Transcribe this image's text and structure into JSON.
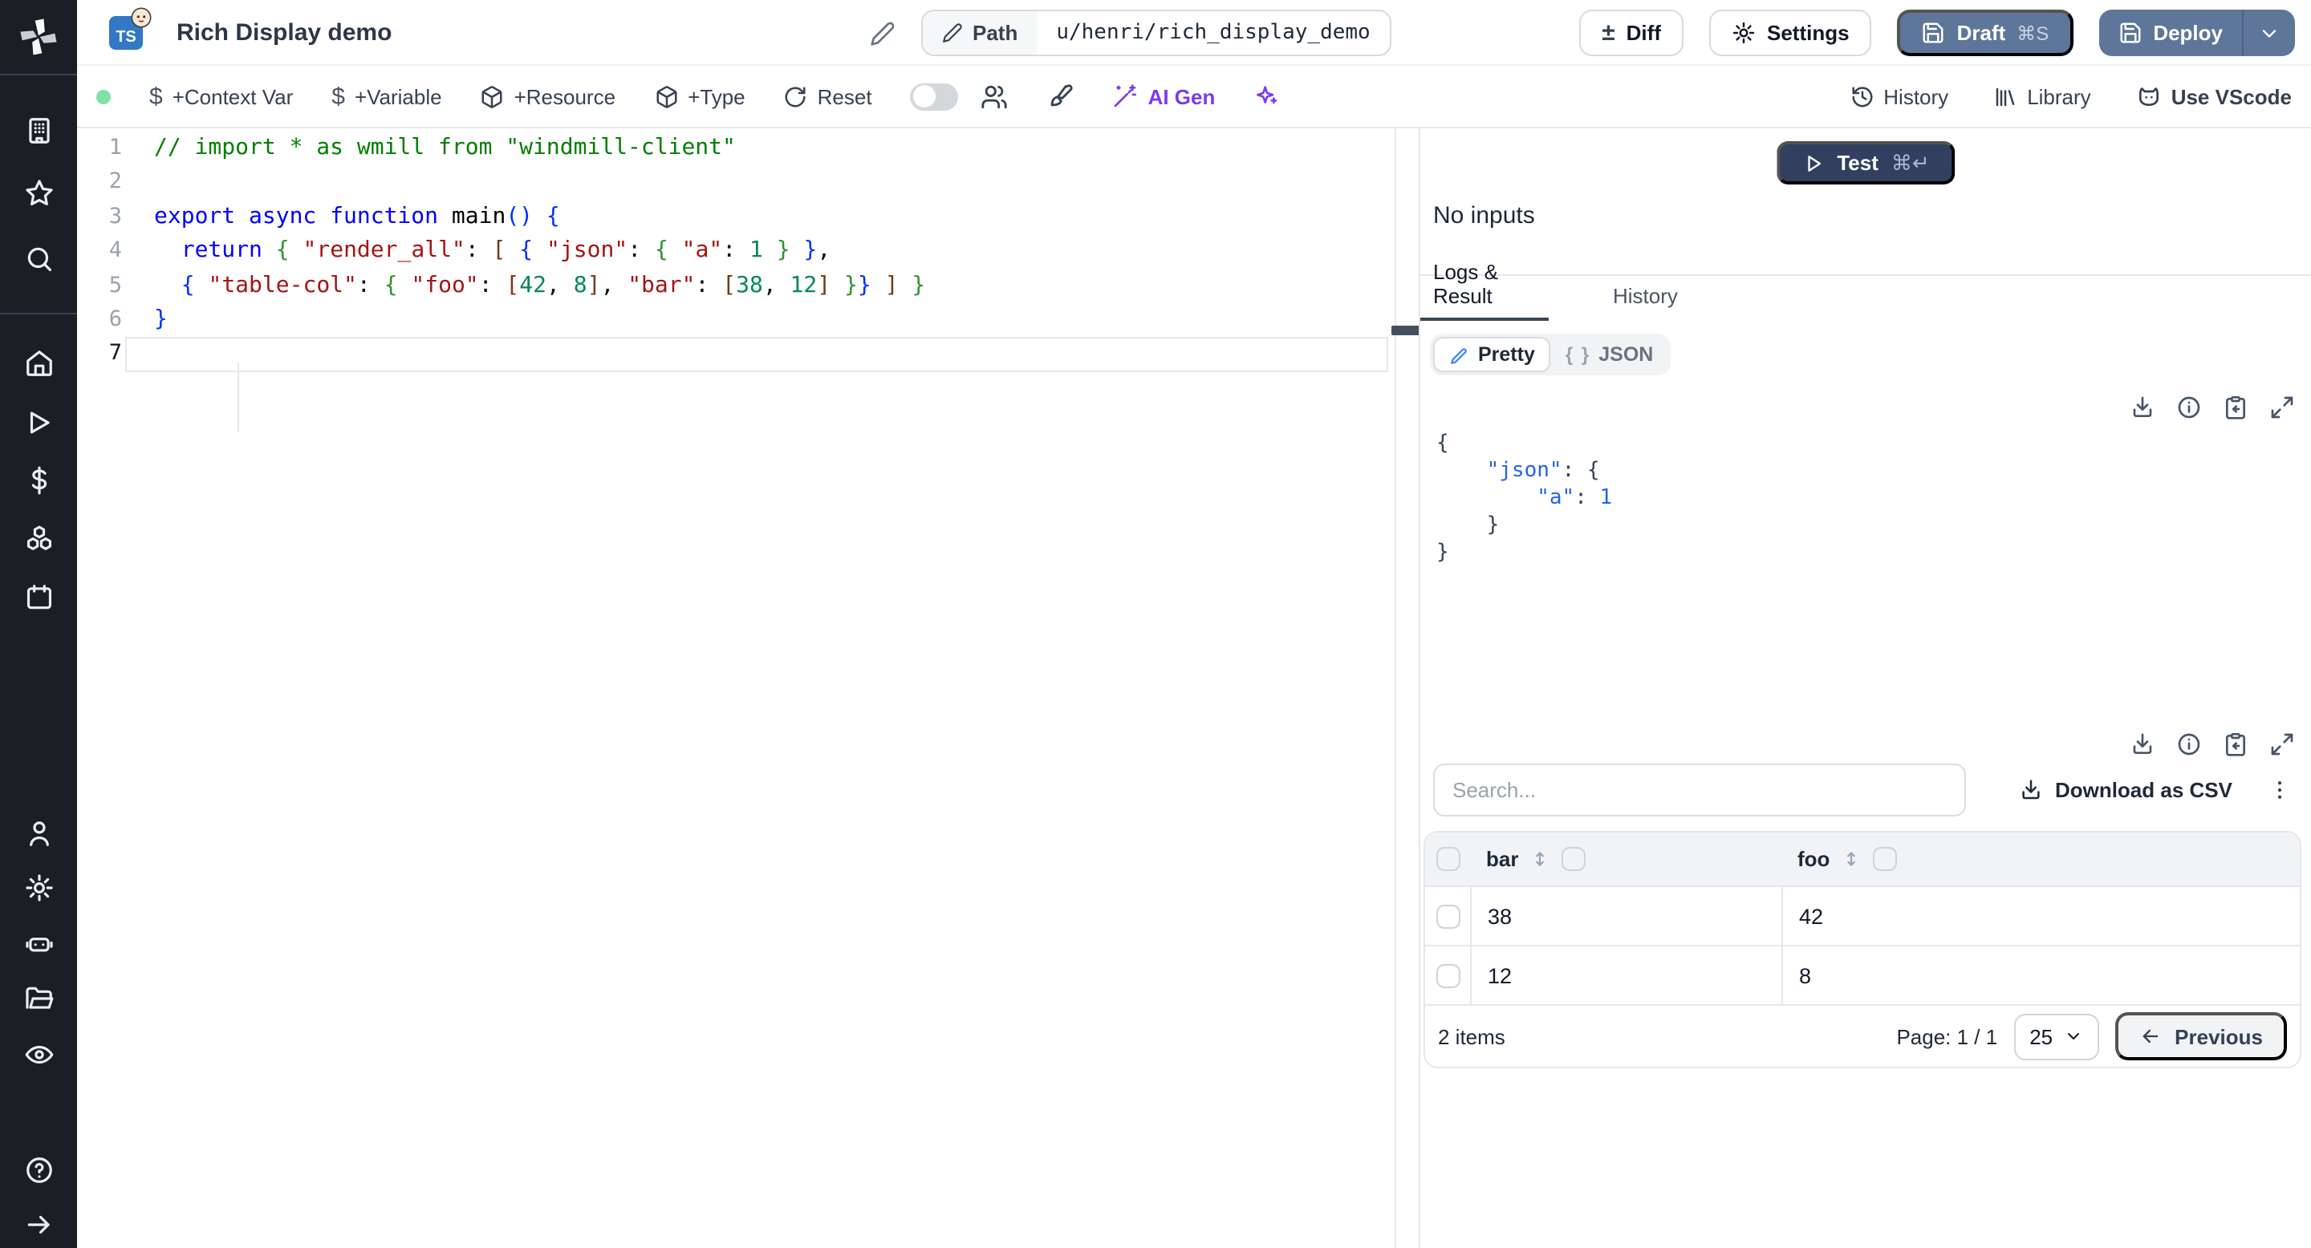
{
  "colors": {
    "accent_slate": "#5e7699",
    "accent_navy": "#323f5e",
    "accent_purple": "#7c3aed",
    "status_green_dot": "#7fe0a7",
    "tab_underline": "#3b4656",
    "sidebar_bg": "#1b1e24",
    "ts_badge_blue": "#3178c6"
  },
  "sidebar": {
    "icons": [
      "windmill-logo",
      "building",
      "star",
      "search",
      "home",
      "play",
      "dollar",
      "cubes",
      "calendar",
      "user",
      "gear",
      "robot",
      "folder-open",
      "eye",
      "help",
      "arrow-right"
    ]
  },
  "header": {
    "title": "Rich Display demo",
    "ts_badge": "TS",
    "path_label": "Path",
    "path_value": "u/henri/rich_display_demo",
    "diff_label": "Diff",
    "diff_glyph": "±",
    "settings_label": "Settings",
    "draft_label": "Draft",
    "draft_shortcut": "⌘S",
    "deploy_label": "Deploy"
  },
  "toolbar": {
    "dollar_glyph": "$",
    "context_var": "+Context Var",
    "variable": "+Variable",
    "resource": "+Resource",
    "type": "+Type",
    "reset": "Reset",
    "ai_gen": "AI Gen",
    "history": "History",
    "library": "Library",
    "use_vscode": "Use VScode"
  },
  "editor": {
    "lines": [
      {
        "num": "1",
        "tokens": [
          {
            "t": "// import * as wmill from \"windmill-client\"",
            "c": "com"
          }
        ]
      },
      {
        "num": "2",
        "tokens": []
      },
      {
        "num": "3",
        "tokens": [
          {
            "t": "export async function ",
            "c": "kw"
          },
          {
            "t": "main",
            "c": "fn"
          },
          {
            "t": "()",
            "c": "b1"
          },
          {
            "t": " ",
            "c": "pln"
          },
          {
            "t": "{",
            "c": "b1"
          }
        ]
      },
      {
        "num": "4",
        "tokens": [
          {
            "t": "  ",
            "c": "pln"
          },
          {
            "t": "return",
            "c": "kw"
          },
          {
            "t": " ",
            "c": "pln"
          },
          {
            "t": "{",
            "c": "b2"
          },
          {
            "t": " ",
            "c": "pln"
          },
          {
            "t": "\"render_all\"",
            "c": "str"
          },
          {
            "t": ": ",
            "c": "pln"
          },
          {
            "t": "[",
            "c": "b3"
          },
          {
            "t": " ",
            "c": "pln"
          },
          {
            "t": "{",
            "c": "b1"
          },
          {
            "t": " ",
            "c": "pln"
          },
          {
            "t": "\"json\"",
            "c": "str"
          },
          {
            "t": ": ",
            "c": "pln"
          },
          {
            "t": "{",
            "c": "b2"
          },
          {
            "t": " ",
            "c": "pln"
          },
          {
            "t": "\"a\"",
            "c": "str"
          },
          {
            "t": ": ",
            "c": "pln"
          },
          {
            "t": "1",
            "c": "num"
          },
          {
            "t": " ",
            "c": "pln"
          },
          {
            "t": "}",
            "c": "b2"
          },
          {
            "t": " ",
            "c": "pln"
          },
          {
            "t": "}",
            "c": "b1"
          },
          {
            "t": ",",
            "c": "pln"
          }
        ]
      },
      {
        "num": "5",
        "tokens": [
          {
            "t": "  ",
            "c": "pln"
          },
          {
            "t": "{",
            "c": "b1"
          },
          {
            "t": " ",
            "c": "pln"
          },
          {
            "t": "\"table-col\"",
            "c": "str"
          },
          {
            "t": ": ",
            "c": "pln"
          },
          {
            "t": "{",
            "c": "b2"
          },
          {
            "t": " ",
            "c": "pln"
          },
          {
            "t": "\"foo\"",
            "c": "str"
          },
          {
            "t": ": ",
            "c": "pln"
          },
          {
            "t": "[",
            "c": "b3"
          },
          {
            "t": "42",
            "c": "num"
          },
          {
            "t": ", ",
            "c": "pln"
          },
          {
            "t": "8",
            "c": "num"
          },
          {
            "t": "]",
            "c": "b3"
          },
          {
            "t": ", ",
            "c": "pln"
          },
          {
            "t": "\"bar\"",
            "c": "str"
          },
          {
            "t": ": ",
            "c": "pln"
          },
          {
            "t": "[",
            "c": "b3"
          },
          {
            "t": "38",
            "c": "num"
          },
          {
            "t": ", ",
            "c": "pln"
          },
          {
            "t": "12",
            "c": "num"
          },
          {
            "t": "]",
            "c": "b3"
          },
          {
            "t": " ",
            "c": "pln"
          },
          {
            "t": "}",
            "c": "b2"
          },
          {
            "t": "}",
            "c": "b1"
          },
          {
            "t": " ",
            "c": "pln"
          },
          {
            "t": "]",
            "c": "b3"
          },
          {
            "t": " ",
            "c": "pln"
          },
          {
            "t": "}",
            "c": "b2"
          }
        ]
      },
      {
        "num": "6",
        "tokens": [
          {
            "t": "}",
            "c": "b1"
          }
        ]
      },
      {
        "num": "7",
        "tokens": [],
        "current": true
      }
    ]
  },
  "right_panel": {
    "test_button": {
      "label": "Test",
      "shortcut": "⌘↵"
    },
    "no_inputs": "No inputs",
    "tabs": {
      "logs_result": "Logs & Result",
      "history": "History"
    },
    "view_toggle": {
      "pretty": "Pretty",
      "json": "JSON",
      "json_glyph": "{ }"
    },
    "result_lines": [
      [
        {
          "t": "{",
          "c": "pln"
        }
      ],
      [
        {
          "t": "    ",
          "c": "pln"
        },
        {
          "t": "\"json\"",
          "c": "key"
        },
        {
          "t": ": ",
          "c": "pln"
        },
        {
          "t": "{",
          "c": "pln"
        }
      ],
      [
        {
          "t": "        ",
          "c": "pln"
        },
        {
          "t": "\"a\"",
          "c": "key"
        },
        {
          "t": ": ",
          "c": "pln"
        },
        {
          "t": "1",
          "c": "val"
        }
      ],
      [
        {
          "t": "    ",
          "c": "pln"
        },
        {
          "t": "}",
          "c": "pln"
        }
      ],
      [
        {
          "t": "}",
          "c": "pln"
        }
      ]
    ],
    "result_icons": [
      "download-icon",
      "info-icon",
      "clipboard-copy-icon",
      "expand-icon"
    ],
    "search_placeholder": "Search...",
    "download_csv": "Download as CSV",
    "table": {
      "columns": [
        "bar",
        "foo"
      ],
      "rows": [
        [
          "38",
          "42"
        ],
        [
          "12",
          "8"
        ]
      ]
    },
    "footer": {
      "items": "2 items",
      "page": "Page: 1 / 1",
      "page_size": "25",
      "previous": "Previous"
    }
  }
}
